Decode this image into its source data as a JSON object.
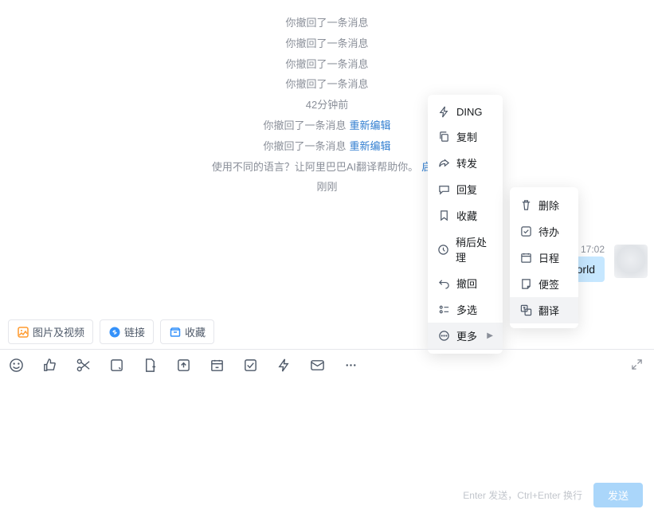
{
  "systemLines": {
    "recall1": "你撤回了一条消息",
    "recall2": "你撤回了一条消息",
    "recall3": "你撤回了一条消息",
    "recall4": "你撤回了一条消息",
    "time1": "42分钟前",
    "recall5_text": "你撤回了一条消息",
    "recall5_edit": "重新编辑",
    "recall6_text": "你撤回了一条消息",
    "recall6_edit": "重新编辑",
    "ai_text": "使用不同的语言？让阿里巴巴AI翻译帮助你。",
    "ai_link": "启用",
    "time2": "刚刚"
  },
  "message": {
    "time": "17:02",
    "bubble": "orld"
  },
  "quickLinks": {
    "media": "图片及视频",
    "link": "链接",
    "fav": "收藏"
  },
  "menu1": {
    "ding": "DING",
    "copy": "复制",
    "forward": "转发",
    "reply": "回复",
    "favorite": "收藏",
    "later": "稍后处理",
    "recall": "撤回",
    "multi": "多选",
    "more": "更多"
  },
  "menu2": {
    "delete": "删除",
    "todo": "待办",
    "schedule": "日程",
    "note": "便签",
    "translate": "翻译"
  },
  "footer": {
    "hint": "Enter 发送，Ctrl+Enter 换行",
    "send": "发送"
  }
}
